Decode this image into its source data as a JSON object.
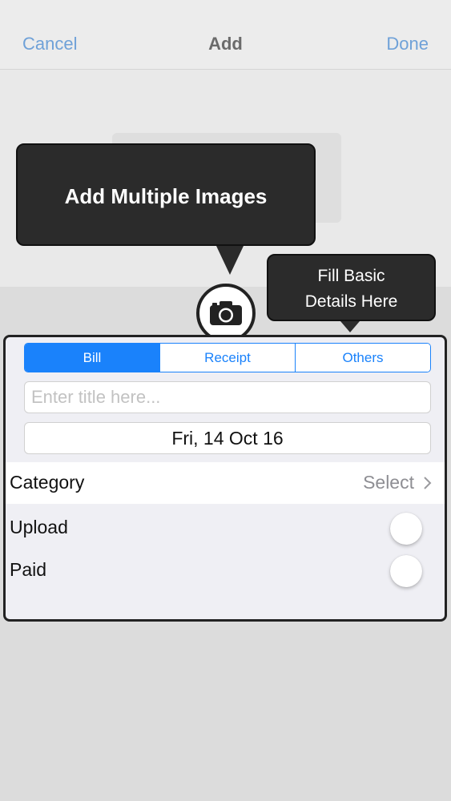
{
  "navbar": {
    "cancel_label": "Cancel",
    "title": "Add",
    "done_label": "Done"
  },
  "tooltips": {
    "main": "Add Multiple Images",
    "fill_line1": "Fill Basic",
    "fill_line2": "Details Here"
  },
  "camera": {
    "icon": "camera-icon"
  },
  "segments": {
    "items": [
      "Bill",
      "Receipt",
      "Others"
    ],
    "selected": "Bill"
  },
  "form": {
    "title_placeholder": "Enter title here...",
    "title_value": "",
    "date": "Fri, 14 Oct 16",
    "category_label": "Category",
    "category_value": "Select",
    "upload_label": "Upload",
    "paid_label": "Paid"
  },
  "colors": {
    "accent": "#1a82fb",
    "nav_link": "#6fa1d8",
    "tooltip_bg": "#2b2b2b"
  }
}
